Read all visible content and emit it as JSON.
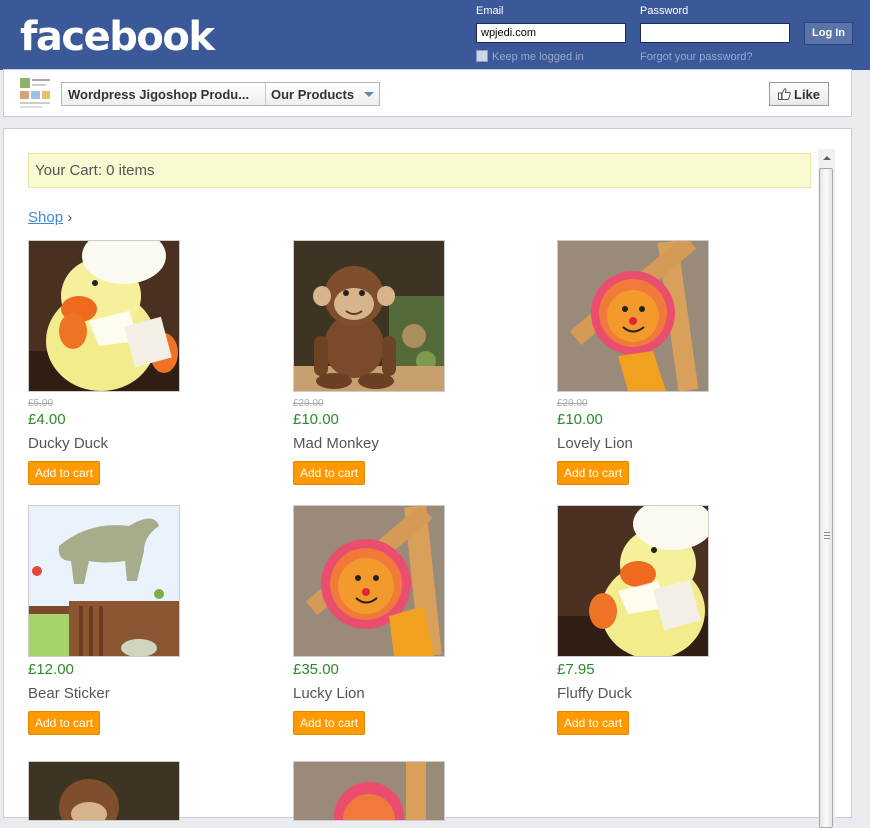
{
  "header": {
    "logo": "facebook",
    "email_label": "Email",
    "email_value": "wpjedi.com",
    "password_label": "Password",
    "password_value": "",
    "login_label": "Log In",
    "keep_logged_in": "Keep me logged in",
    "forgot_password": "Forgot your password?"
  },
  "page_bar": {
    "page_name": "Wordpress Jigoshop Produ...",
    "section": "Our Products",
    "like_label": "Like"
  },
  "cart": {
    "text": "Your Cart: 0 items"
  },
  "breadcrumb": {
    "shop": "Shop",
    "separator": "›"
  },
  "products": [
    {
      "name": "Ducky Duck",
      "old_price": "£5.00",
      "price": "£4.00",
      "button": "Add to cart",
      "image": "duck-toy"
    },
    {
      "name": "Mad Monkey",
      "old_price": "£20.00",
      "price": "£10.00",
      "button": "Add to cart",
      "image": "monkey-toy"
    },
    {
      "name": "Lovely Lion",
      "old_price": "£20.00",
      "price": "£10.00",
      "button": "Add to cart",
      "image": "lion-toy"
    },
    {
      "name": "Bear Sticker",
      "price": "£12.00",
      "button": "Add to cart",
      "image": "bear-sticker"
    },
    {
      "name": "Lucky Lion",
      "price": "£35.00",
      "button": "Add to cart",
      "image": "lion-toy"
    },
    {
      "name": "Fluffy Duck",
      "price": "£7.95",
      "button": "Add to cart",
      "image": "duck-toy"
    }
  ],
  "colors": {
    "facebook_blue": "#3b5998",
    "button_orange": "#ff9900",
    "price_green": "#2a8a2a",
    "cart_bg": "#fafad2"
  }
}
